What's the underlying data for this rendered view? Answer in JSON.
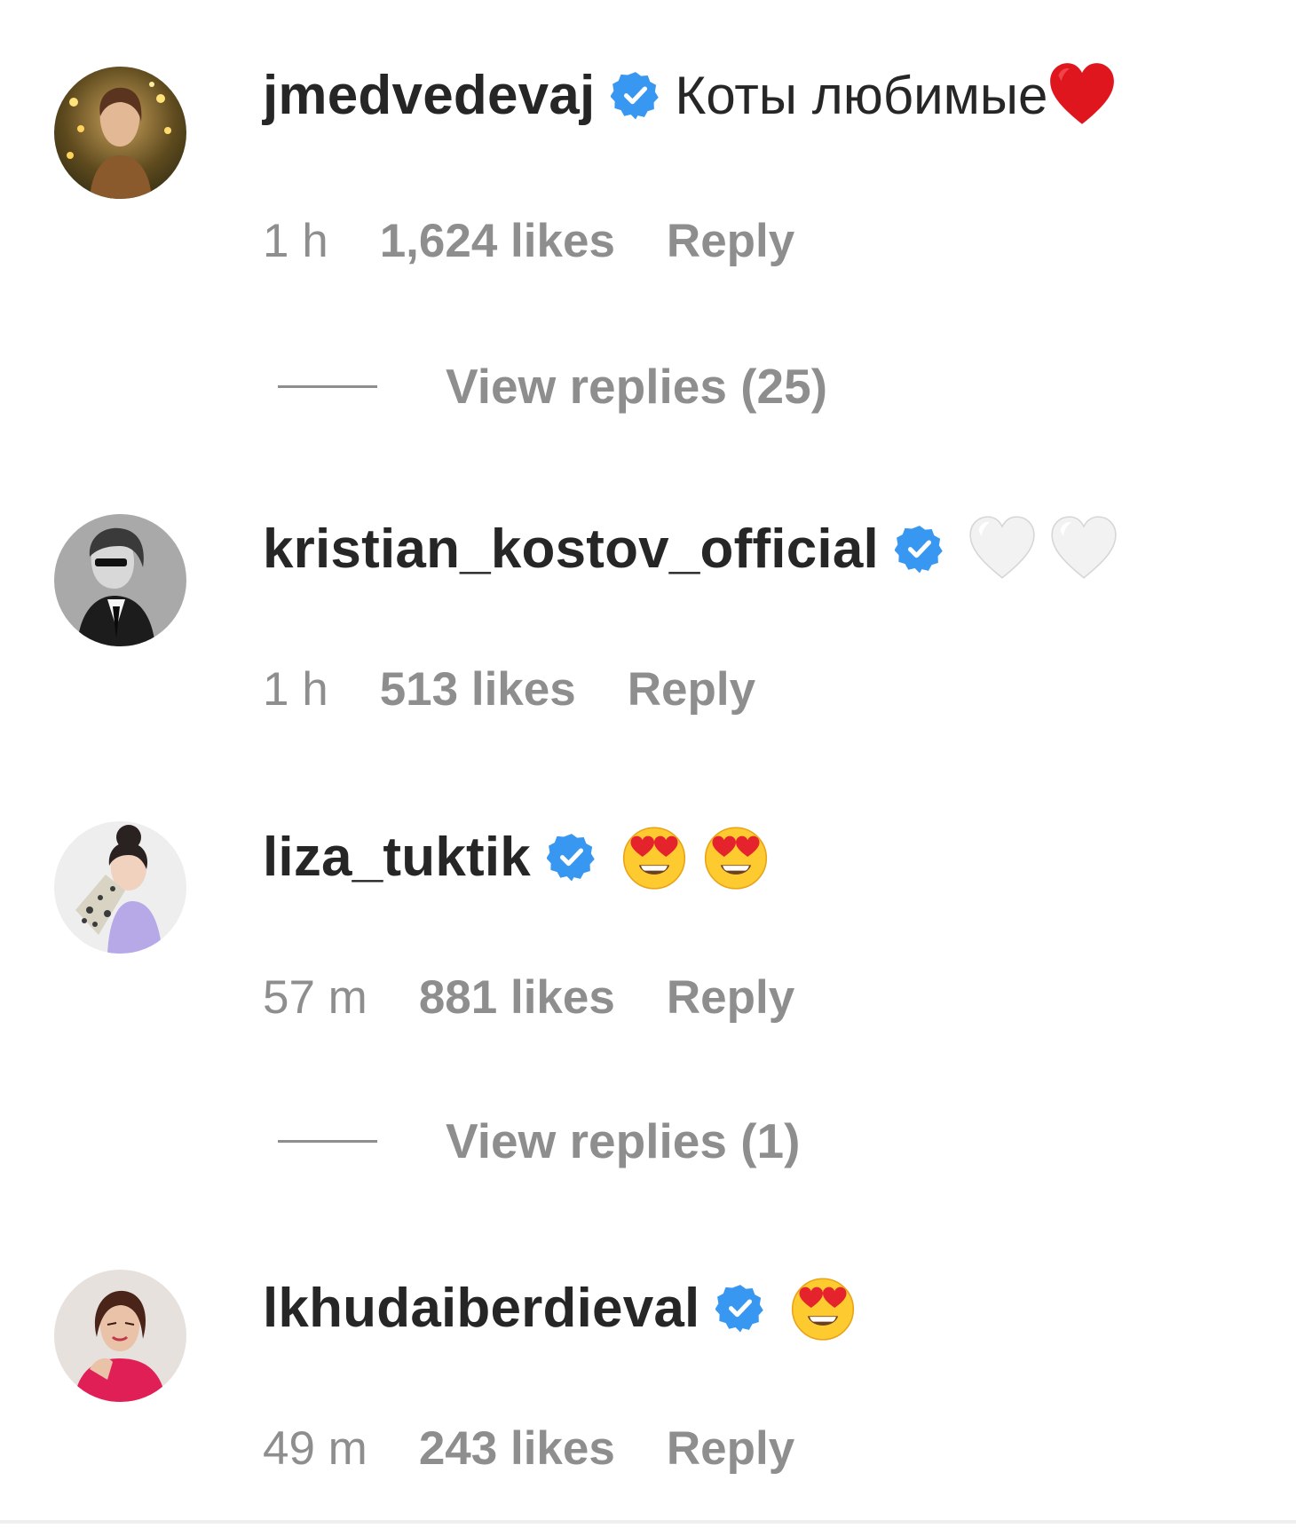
{
  "colors": {
    "username": "#262626",
    "meta": "#8e8e8e",
    "verified_badge": "#3897f0"
  },
  "comments": [
    {
      "username": "jmedvedevaj",
      "verified": true,
      "text": "Коты любимые",
      "emojis": [
        "red-heart"
      ],
      "time": "1 h",
      "likes": "1,624 likes",
      "reply": "Reply",
      "view_replies": "View replies (25)"
    },
    {
      "username": "kristian_kostov_official",
      "verified": true,
      "text": "",
      "emojis": [
        "white-heart",
        "white-heart"
      ],
      "time": "1 h",
      "likes": "513 likes",
      "reply": "Reply"
    },
    {
      "username": "liza_tuktik",
      "verified": true,
      "text": "",
      "emojis": [
        "heart-eyes",
        "heart-eyes"
      ],
      "time": "57 m",
      "likes": "881 likes",
      "reply": "Reply",
      "view_replies": "View replies (1)"
    },
    {
      "username": "lkhudaiberdieval",
      "verified": true,
      "text": "",
      "emojis": [
        "heart-eyes"
      ],
      "time": "49 m",
      "likes": "243 likes",
      "reply": "Reply"
    }
  ]
}
